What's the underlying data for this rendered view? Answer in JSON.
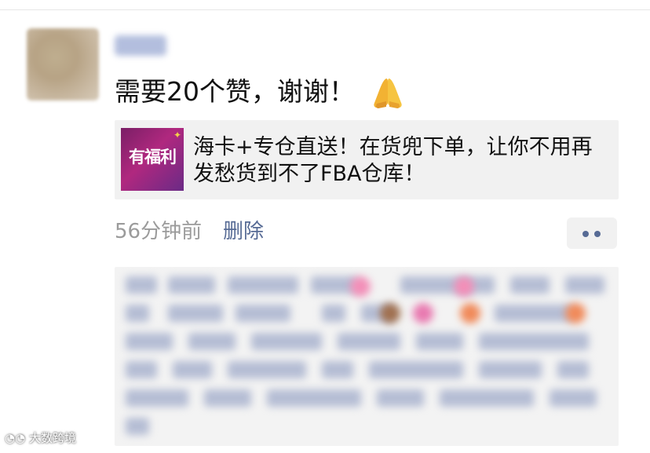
{
  "post": {
    "text": "需要20个赞，谢谢！",
    "emoji_icon": "folded-hands-icon"
  },
  "link_card": {
    "thumb_label": "有福利",
    "title": "海卡+专仓直送！在货兜下单，让你不用再发愁货到不了FBA仓库！"
  },
  "meta": {
    "time": "56分钟前",
    "delete_label": "删除",
    "more_icon": "more-dots-icon"
  },
  "comments": {
    "blurred": true
  },
  "watermark": {
    "text": "大数跨境"
  },
  "colors": {
    "link_blue": "#576b95",
    "meta_gray": "#9b9b9b",
    "card_bg": "#f1f1f1"
  }
}
